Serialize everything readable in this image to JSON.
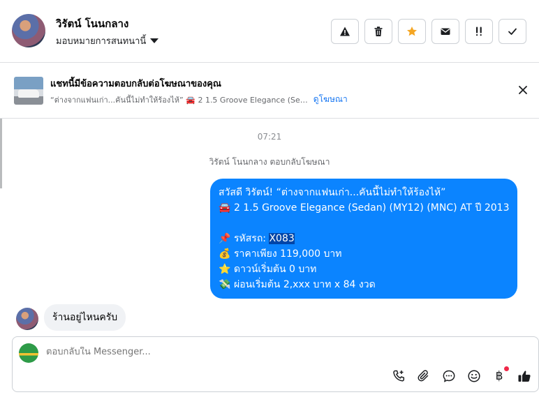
{
  "header": {
    "contact_name": "วิรัตน์ โนนกลาง",
    "assign_label": "มอบหมายการสนทนานี้",
    "toolbar_icons": [
      "warning-icon",
      "trash-icon",
      "star-icon",
      "envelope-icon",
      "follow-up-icon",
      "check-icon"
    ],
    "star_color": "#f5a623"
  },
  "banner": {
    "title": "แชทนี้มีข้อความตอบกลับต่อโฆษณาของคุณ",
    "ad_text": "“ต่างจากแฟนเก่า...คันนี้ไม่ทำให้ร้องไห้” 🚘 2 1.5 Groove Elegance (Se…",
    "link": "ดูโฆษณา"
  },
  "conversation": {
    "time": "07:21",
    "system_message": "วิรัตน์ โนนกลาง ตอบกลับโฆษณา",
    "outgoing": {
      "line1": "สวัสดี วิรัตน์! “ต่างจากแฟนเก่า...คันนี้ไม่ทำให้ร้องไห้”",
      "line2_emoji": "🚘",
      "line2": "2 1.5 Groove Elegance (Sedan) (MY12) (MNC) AT ปี 2013",
      "line3_emoji": "📌",
      "line3_label": "รหัสรถ: ",
      "line3_code": "X083",
      "line4_emoji": "💰",
      "line4": "ราคาเพียง 119,000 บาท",
      "line5_emoji": "⭐",
      "line5": "ดาวน์เริ่มต้น 0 บาท",
      "line6_emoji": "💸",
      "line6": "ผ่อนเริ่มต้น 2,xxx บาท x 84 งวด",
      "bubble_color": "#0b84ff"
    },
    "incoming": {
      "text": "ร้านอยู่ไหนครับ"
    }
  },
  "composer": {
    "placeholder": "ตอบกลับใน Messenger...",
    "baht_symbol": "฿",
    "icons": [
      "call-add-icon",
      "paperclip-icon",
      "chat-bubble-icon",
      "emoji-icon",
      "baht-icon",
      "thumbs-up-icon"
    ]
  }
}
